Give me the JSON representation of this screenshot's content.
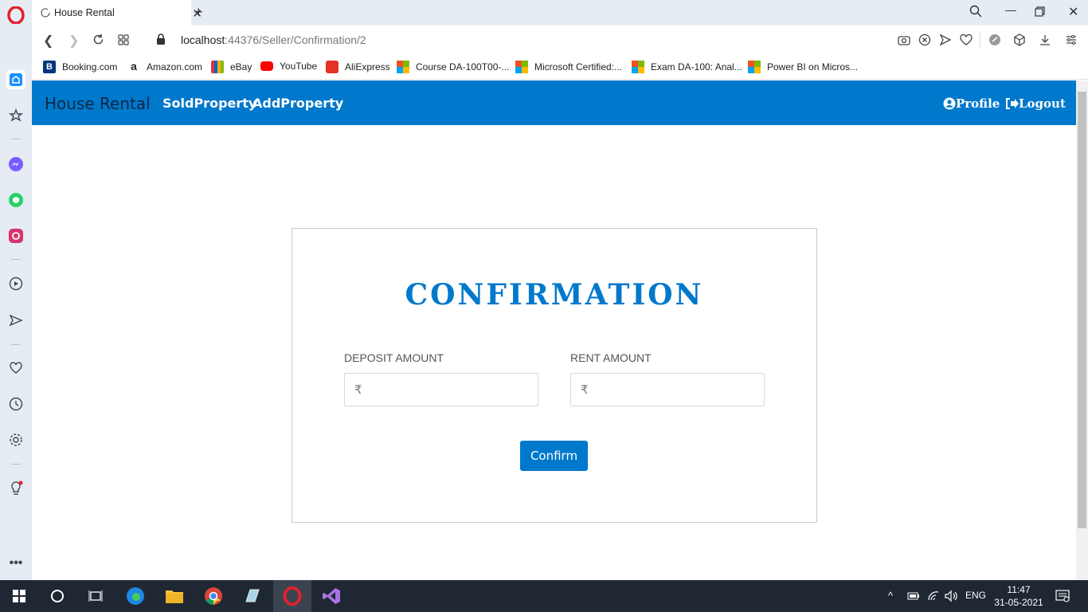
{
  "browser": {
    "tab_title": "House Rental",
    "url_host": "localhost",
    "url_path": ":44376/Seller/Confirmation/2",
    "bookmarks": [
      {
        "label": "Booking.com",
        "icon": "booking-icon"
      },
      {
        "label": "Amazon.com",
        "icon": "amazon-icon"
      },
      {
        "label": "eBay",
        "icon": "ebay-icon"
      },
      {
        "label": "YouTube",
        "icon": "youtube-icon"
      },
      {
        "label": "AliExpress",
        "icon": "aliexpress-icon"
      },
      {
        "label": "Course DA-100T00-...",
        "icon": "microsoft-icon"
      },
      {
        "label": "Microsoft Certified:...",
        "icon": "microsoft-icon"
      },
      {
        "label": "Exam DA-100: Anal...",
        "icon": "microsoft-icon"
      },
      {
        "label": "Power BI on Micros...",
        "icon": "microsoft-icon"
      }
    ]
  },
  "app": {
    "brand": "House Rental",
    "nav_links": [
      "SoldProperty",
      "AddProperty"
    ],
    "profile": "Profile",
    "logout": "Logout",
    "accent": "#0078cc"
  },
  "form": {
    "title": "CONFIRMATION",
    "deposit_label": "DEPOSIT AMOUNT",
    "rent_label": "RENT AMOUNT",
    "currency_symbol": "₹",
    "deposit_value": "",
    "rent_value": "",
    "confirm_label": "Confirm"
  },
  "taskbar": {
    "language": "ENG",
    "time": "11:47",
    "date": "31-05-2021"
  }
}
